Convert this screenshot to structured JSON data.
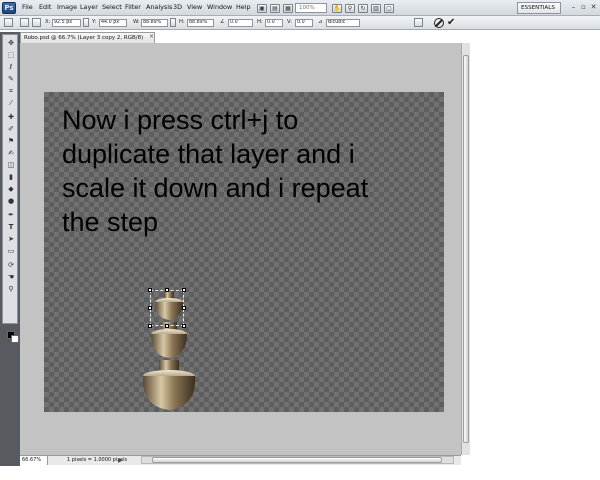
{
  "app": {
    "logo": "Ps",
    "menus": [
      "File",
      "Edit",
      "Image",
      "Layer",
      "Select",
      "Filter",
      "Analysis",
      "3D",
      "View",
      "Window",
      "Help"
    ],
    "zoom": "100%",
    "workspace": "ESSENTIALS",
    "window_controls": [
      "–",
      "▫",
      "✕"
    ]
  },
  "options_bar": {
    "x_label": "X:",
    "x_value": "92.5 px",
    "y_label": "Y:",
    "y_value": "44.0 px",
    "w_label": "W:",
    "w_value": "88.89%",
    "h_label": "H:",
    "h_value": "88.89%",
    "angle_value": "0.0",
    "h_skew_label": "H:",
    "h_skew_value": "0.0",
    "v_skew_label": "V:",
    "v_skew_value": "0.0",
    "interpolation": "Bicubic"
  },
  "document": {
    "tab_title": "Robo.psd @ 66.7% (Layer 3 copy 2, RGB/8)",
    "tab_close": "×",
    "canvas_text": "Now i press ctrl+j to duplicate that layer and i scale it down and i repeat the step",
    "status_zoom": "66.67%",
    "status_info": "1 pixels = 1.0000 pixels",
    "status_arrow": "▶"
  },
  "colors": {
    "foreground": "#000000",
    "background": "#ffffff",
    "metal_light": "#d9c8a6",
    "metal_dark": "#5a4a33"
  },
  "icons": [
    "move-tool-icon",
    "marquee-tool-icon",
    "lasso-tool-icon",
    "quick-select-icon",
    "crop-tool-icon",
    "eyedropper-icon",
    "healing-brush-icon",
    "brush-tool-icon",
    "clone-stamp-icon",
    "history-brush-icon",
    "eraser-icon",
    "gradient-icon",
    "blur-icon",
    "dodge-icon",
    "pen-tool-icon",
    "type-tool-icon",
    "path-select-icon",
    "shape-tool-icon",
    "3d-rotate-icon",
    "hand-tool-icon",
    "zoom-tool-icon"
  ]
}
